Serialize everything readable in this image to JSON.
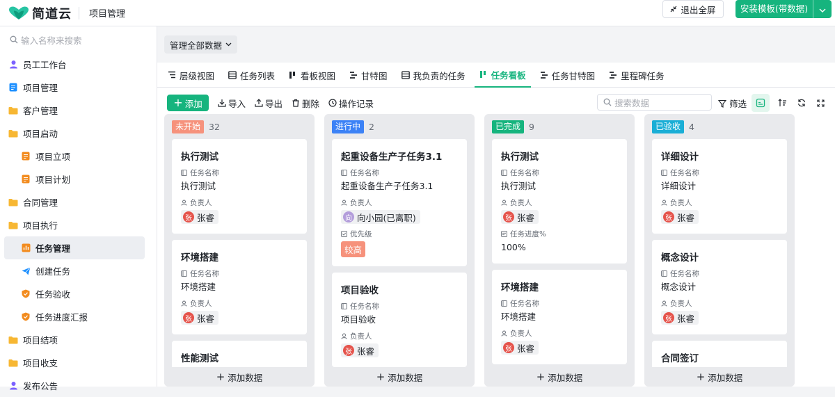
{
  "header": {
    "logo_text": "简道云",
    "app_title": "项目管理",
    "exit_fullscreen_label": "退出全屏",
    "install_label": "安装模板(带数据)"
  },
  "sidebar": {
    "search_placeholder": "输入名称来搜索",
    "items": [
      {
        "label": "员工工作台",
        "icon": "person-icon",
        "level": 0
      },
      {
        "label": "项目管理",
        "icon": "doc-icon",
        "level": 0
      },
      {
        "label": "客户管理",
        "icon": "folder-icon",
        "level": 0
      },
      {
        "label": "项目启动",
        "icon": "folder-icon",
        "level": 0
      },
      {
        "label": "项目立项",
        "icon": "form-icon",
        "level": 1
      },
      {
        "label": "项目计划",
        "icon": "form-icon",
        "level": 1
      },
      {
        "label": "合同管理",
        "icon": "folder-icon",
        "level": 0
      },
      {
        "label": "项目执行",
        "icon": "folder-icon",
        "level": 0
      },
      {
        "label": "任务管理",
        "icon": "dashboard-icon",
        "level": 1,
        "active": true
      },
      {
        "label": "创建任务",
        "icon": "send-icon",
        "level": 1
      },
      {
        "label": "任务验收",
        "icon": "shield-icon",
        "level": 1
      },
      {
        "label": "任务进度汇报",
        "icon": "shield-icon",
        "level": 1
      },
      {
        "label": "项目结项",
        "icon": "folder-icon",
        "level": 0
      },
      {
        "label": "项目收支",
        "icon": "folder-icon",
        "level": 0
      },
      {
        "label": "发布公告",
        "icon": "person-icon",
        "level": 0
      }
    ]
  },
  "filter": {
    "label": "管理全部数据"
  },
  "tabs": [
    {
      "label": "层级视图",
      "icon": "hierarchy-icon"
    },
    {
      "label": "任务列表",
      "icon": "table-icon"
    },
    {
      "label": "看板视图",
      "icon": "kanban-icon"
    },
    {
      "label": "甘特图",
      "icon": "gantt-icon"
    },
    {
      "label": "我负责的任务",
      "icon": "table-icon"
    },
    {
      "label": "任务看板",
      "icon": "kanban-icon",
      "active": true
    },
    {
      "label": "任务甘特图",
      "icon": "gantt-icon"
    },
    {
      "label": "里程碑任务",
      "icon": "gantt-icon"
    }
  ],
  "toolbar": {
    "add_label": "添加",
    "import_label": "导入",
    "export_label": "导出",
    "delete_label": "删除",
    "log_label": "操作记录",
    "search_placeholder": "搜索数据",
    "filter_label": "筛选"
  },
  "colors": {
    "accent": "#16b47e",
    "not_started": "#f6927c",
    "in_progress": "#3c82f6",
    "done": "#16b47e",
    "accepted": "#1aaed6"
  },
  "columns": [
    {
      "status": "未开始",
      "count": "32",
      "color": "#f6927c",
      "cards": [
        {
          "title": "执行测试",
          "f1_label": "任务名称",
          "f1_value": "执行测试",
          "f2_label": "负责人",
          "avatar": "张",
          "person": "张睿"
        },
        {
          "title": "环境搭建",
          "f1_label": "任务名称",
          "f1_value": "环境搭建",
          "f2_label": "负责人",
          "avatar": "张",
          "person": "张睿"
        },
        {
          "title": "性能测试"
        }
      ]
    },
    {
      "status": "进行中",
      "count": "2",
      "color": "#3c82f6",
      "cards": [
        {
          "title": "起重设备生产子任务3.1",
          "f1_label": "任务名称",
          "f1_value": "起重设备生产子任务3.1",
          "f2_label": "负责人",
          "avatar": "向",
          "person": "向小园(已离职)",
          "f3_label": "优先级",
          "priority": "较高"
        },
        {
          "title": "项目验收",
          "f1_label": "任务名称",
          "f1_value": "项目验收",
          "f2_label": "负责人",
          "avatar": "张",
          "person": "张睿"
        }
      ]
    },
    {
      "status": "已完成",
      "count": "9",
      "color": "#16b47e",
      "cards": [
        {
          "title": "执行测试",
          "f1_label": "任务名称",
          "f1_value": "执行测试",
          "f2_label": "负责人",
          "avatar": "张",
          "person": "张睿",
          "f3_label": "任务进度%",
          "progress": "100%"
        },
        {
          "title": "环境搭建",
          "f1_label": "任务名称",
          "f1_value": "环境搭建",
          "f2_label": "负责人",
          "avatar": "张",
          "person": "张睿"
        }
      ]
    },
    {
      "status": "已验收",
      "count": "4",
      "color": "#1aaed6",
      "cards": [
        {
          "title": "详细设计",
          "f1_label": "任务名称",
          "f1_value": "详细设计",
          "f2_label": "负责人",
          "avatar": "张",
          "person": "张睿"
        },
        {
          "title": "概念设计",
          "f1_label": "任务名称",
          "f1_value": "概念设计",
          "f2_label": "负责人",
          "avatar": "张",
          "person": "张睿"
        },
        {
          "title": "合同签订"
        }
      ]
    }
  ],
  "add_data_label": "添加数据"
}
